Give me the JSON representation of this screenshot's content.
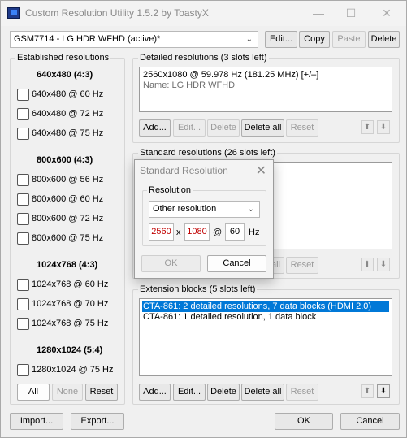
{
  "window": {
    "title": "Custom Resolution Utility 1.5.2 by ToastyX",
    "controls": {
      "minimize": "—",
      "maximize": "☐",
      "close": "✕"
    }
  },
  "top_bar": {
    "display_select": "GSM7714 - LG HDR WFHD (active)*",
    "edit": "Edit...",
    "copy": "Copy",
    "paste": "Paste",
    "delete": "Delete"
  },
  "established": {
    "title": "Established resolutions",
    "groups": [
      {
        "heading": "640x480 (4:3)",
        "items": [
          "640x480 @ 60 Hz",
          "640x480 @ 72 Hz",
          "640x480 @ 75 Hz"
        ]
      },
      {
        "heading": "800x600 (4:3)",
        "items": [
          "800x600 @ 56 Hz",
          "800x600 @ 60 Hz",
          "800x600 @ 72 Hz",
          "800x600 @ 75 Hz"
        ]
      },
      {
        "heading": "1024x768 (4:3)",
        "items": [
          "1024x768 @ 60 Hz",
          "1024x768 @ 70 Hz",
          "1024x768 @ 75 Hz"
        ]
      },
      {
        "heading": "1280x1024 (5:4)",
        "items": [
          "1280x1024 @ 75 Hz"
        ]
      }
    ],
    "all": "All",
    "none": "None",
    "reset": "Reset"
  },
  "detailed": {
    "title": "Detailed resolutions (3 slots left)",
    "entry": "2560x1080 @ 59.978 Hz (181.25 MHz) [+/–]",
    "name": "Name: LG HDR WFHD",
    "add": "Add...",
    "edit": "Edit...",
    "delete": "Delete",
    "delete_all": "Delete all",
    "reset": "Reset"
  },
  "standard": {
    "title": "Standard resolutions (26 slots left)",
    "add_partial": "all",
    "reset": "Reset"
  },
  "extension": {
    "title": "Extension blocks (5 slots left)",
    "items": [
      "CTA-861: 2 detailed resolutions, 7 data blocks (HDMI 2.0)",
      "CTA-861: 1 detailed resolution, 1 data block"
    ],
    "add": "Add...",
    "edit": "Edit...",
    "delete": "Delete",
    "delete_all": "Delete all",
    "reset": "Reset"
  },
  "arrows": {
    "up": "⬆",
    "down": "⬇"
  },
  "footer": {
    "import": "Import...",
    "export": "Export...",
    "ok": "OK",
    "cancel": "Cancel"
  },
  "dialog": {
    "title": "Standard Resolution",
    "group_label": "Resolution",
    "select_value": "Other resolution",
    "width": "2560",
    "x_label": "x",
    "height": "1080",
    "at_label": "@",
    "refresh": "60",
    "hz_label": "Hz",
    "ok": "OK",
    "cancel": "Cancel"
  }
}
